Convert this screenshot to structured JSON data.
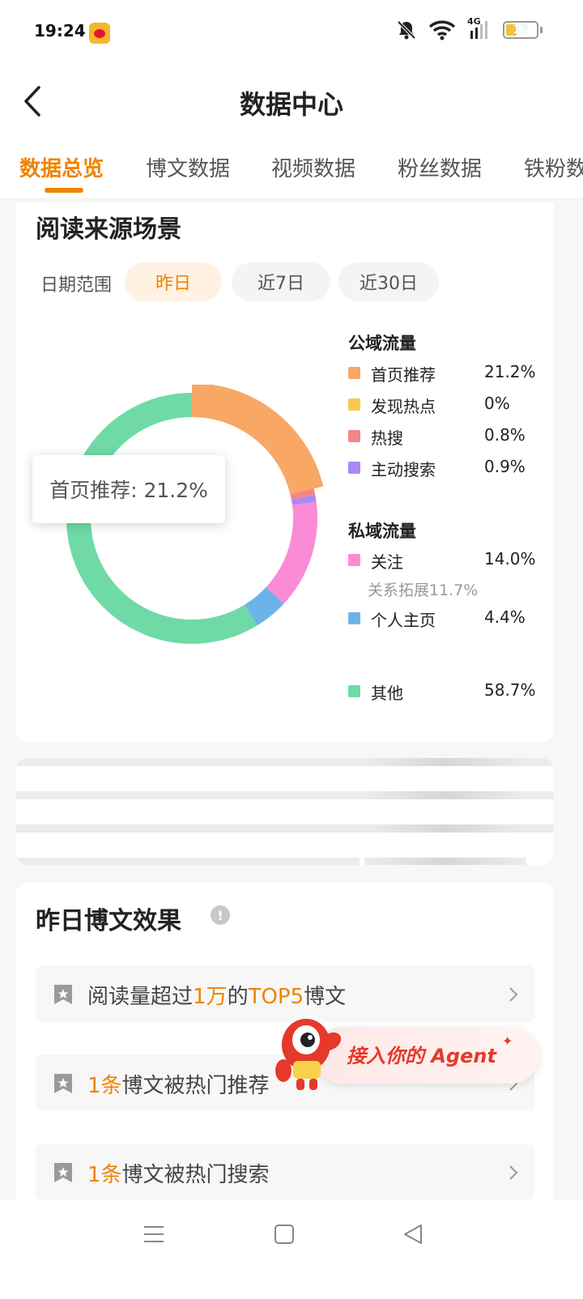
{
  "status_bar": {
    "time": "19:24",
    "network": "4G",
    "battery": "17",
    "icons": [
      "weibo-notification-icon",
      "mute-bell-icon",
      "wifi-icon",
      "signal-icon",
      "battery-icon"
    ]
  },
  "header": {
    "title": "数据中心",
    "back_icon": "chevron-left-icon"
  },
  "tabs": [
    {
      "label": "数据总览",
      "active": true
    },
    {
      "label": "博文数据",
      "active": false
    },
    {
      "label": "视频数据",
      "active": false
    },
    {
      "label": "粉丝数据",
      "active": false
    },
    {
      "label": "铁粉数据",
      "active": false
    }
  ],
  "read_source": {
    "title": "阅读来源场景",
    "date_range_label": "日期范围",
    "date_options": [
      {
        "label": "昨日",
        "active": true
      },
      {
        "label": "近7日",
        "active": false
      },
      {
        "label": "近30日",
        "active": false
      }
    ],
    "tooltip": "首页推荐: 21.2%",
    "public_group": "公域流量",
    "private_group": "私域流量",
    "sub_note": "关系拓展11.7%"
  },
  "chart_data": {
    "type": "pie",
    "donut": true,
    "title": "",
    "series": [
      {
        "name": "首页推荐",
        "value": 21.2,
        "label": "21.2%",
        "color": "#f8a765",
        "group": "公域流量"
      },
      {
        "name": "发现热点",
        "value": 0,
        "label": "0%",
        "color": "#f9c94f",
        "group": "公域流量"
      },
      {
        "name": "热搜",
        "value": 0.8,
        "label": "0.8%",
        "color": "#f48585",
        "group": "公域流量"
      },
      {
        "name": "主动搜索",
        "value": 0.9,
        "label": "0.9%",
        "color": "#a98af2",
        "group": "公域流量"
      },
      {
        "name": "关注",
        "value": 14.0,
        "label": "14.0%",
        "color": "#fb8bd6",
        "group": "私域流量"
      },
      {
        "name": "个人主页",
        "value": 4.4,
        "label": "4.4%",
        "color": "#6cb3ea",
        "group": "私域流量"
      },
      {
        "name": "其他",
        "value": 58.7,
        "label": "58.7%",
        "color": "#6fdaa5",
        "group": ""
      }
    ],
    "highlighted": "首页推荐",
    "legend": "right"
  },
  "yesterday_posts": {
    "title": "昨日博文效果",
    "info_icon": "!",
    "items": [
      {
        "parts": [
          {
            "t": "阅读量超过",
            "hl": false
          },
          {
            "t": "1万",
            "hl": true
          },
          {
            "t": "的",
            "hl": false
          },
          {
            "t": "TOP5",
            "hl": true
          },
          {
            "t": "博文",
            "hl": false
          }
        ]
      },
      {
        "parts": [
          {
            "t": "1条",
            "hl": true
          },
          {
            "t": "博文被热门推荐",
            "hl": false
          }
        ]
      },
      {
        "parts": [
          {
            "t": "1条",
            "hl": true
          },
          {
            "t": "博文被热门搜索",
            "hl": false
          }
        ]
      }
    ]
  },
  "agent_button": {
    "label": "接入你的 Agent"
  },
  "nav_bar": {
    "icons": [
      "menu-icon",
      "home-square-icon",
      "back-triangle-icon"
    ]
  }
}
